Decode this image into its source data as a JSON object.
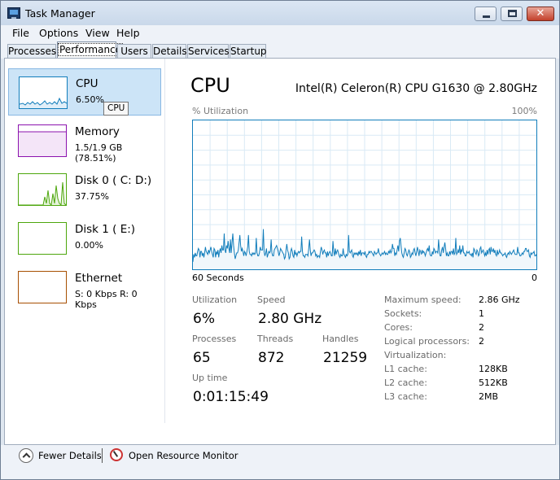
{
  "window": {
    "title": "Task Manager",
    "close_glyph": "✕"
  },
  "menu": [
    "File",
    "Options",
    "View",
    "Help"
  ],
  "tabs": [
    "Processes",
    "Performance",
    "Users",
    "Details",
    "Services",
    "Startup"
  ],
  "active_tab": "Performance",
  "resources": [
    {
      "name": "CPU",
      "detail": "6.50%",
      "color": "#117dbb",
      "selected": true
    },
    {
      "name": "Memory",
      "detail": "1.5/1.9 GB (78.51%)",
      "color": "#8b12ae",
      "selected": false
    },
    {
      "name": "Disk 0 ( C: D:)",
      "detail": "37.75%",
      "color": "#4da60c",
      "selected": false
    },
    {
      "name": "Disk 1 ( E:)",
      "detail": "0.00%",
      "color": "#4da60c",
      "selected": false
    },
    {
      "name": "Ethernet",
      "detail": "S: 0 Kbps R: 0 Kbps",
      "color": "#a74f01",
      "selected": false
    }
  ],
  "tooltip": "CPU",
  "cpu": {
    "heading": "CPU",
    "model": "Intel(R) Celeron(R) CPU G1630 @ 2.80GHz",
    "y_label": "% Utilization",
    "y_max_label": "100%",
    "x_left_label": "60 Seconds",
    "x_right_label": "0",
    "utilization_series": [
      5,
      10,
      8,
      11,
      9,
      9,
      12,
      14,
      13,
      8,
      12,
      12,
      9,
      11,
      8,
      11,
      15,
      12,
      11,
      10,
      13,
      11,
      13,
      15,
      12,
      10,
      8,
      14,
      13,
      8,
      12,
      10,
      13,
      8,
      12,
      14,
      11,
      16,
      13,
      13,
      24,
      13,
      11,
      16,
      14,
      19,
      14,
      11,
      20,
      11,
      18,
      24,
      16,
      11,
      7,
      9,
      11,
      11,
      13,
      18,
      23,
      16,
      12,
      14,
      12,
      9,
      12,
      11,
      9,
      12,
      15,
      23,
      12,
      10,
      10,
      9,
      11,
      10,
      11,
      10,
      11,
      21,
      11,
      9,
      9,
      11,
      15,
      13,
      13,
      13,
      27,
      12,
      9,
      11,
      14,
      8,
      10,
      12,
      11,
      12,
      20,
      11,
      9,
      9,
      13,
      14,
      15,
      16,
      14,
      12,
      9,
      11,
      14,
      13,
      12,
      11,
      10,
      7,
      8,
      13,
      17,
      13,
      11,
      7,
      8,
      12,
      14,
      12,
      9,
      8,
      13,
      10,
      11,
      9,
      11,
      12,
      11,
      12,
      12,
      22,
      12,
      9,
      9,
      8,
      10,
      10,
      10,
      9,
      14,
      20,
      13,
      9,
      11,
      11,
      12,
      13,
      12,
      9,
      10,
      8,
      9,
      9,
      8,
      12,
      15,
      13,
      10,
      12,
      13,
      11,
      11,
      8,
      12,
      9,
      11,
      12,
      11,
      9,
      9,
      19,
      12,
      9,
      14,
      10,
      12,
      13,
      11,
      9,
      8,
      10,
      9,
      9,
      14,
      10,
      9,
      8,
      10,
      9,
      10,
      23,
      12,
      11,
      12,
      13,
      9,
      8,
      11,
      10,
      11,
      10,
      11,
      9,
      12,
      10,
      13,
      9,
      11,
      11,
      11,
      10,
      12,
      9,
      8,
      10,
      10,
      12,
      11,
      12,
      12,
      11,
      10,
      9,
      12,
      11,
      10,
      11,
      11,
      14,
      11,
      10,
      9,
      10,
      11,
      10,
      11,
      12,
      10,
      11,
      10,
      10,
      12,
      11,
      13,
      11,
      12,
      17,
      14,
      14,
      9,
      11,
      10,
      13,
      16,
      12,
      19,
      21,
      16,
      11,
      9,
      8,
      11,
      14,
      13,
      10,
      9,
      11,
      13,
      12,
      8,
      9,
      11,
      10,
      13,
      14,
      11,
      9,
      12,
      15,
      12,
      9,
      13,
      12,
      10,
      13,
      11,
      12,
      11,
      9,
      11,
      13,
      14,
      12,
      16,
      10,
      9,
      9,
      12,
      10,
      14,
      13,
      11,
      12,
      12,
      11,
      20,
      13,
      9,
      9,
      13,
      15,
      11,
      15,
      18,
      14,
      9,
      11,
      9,
      9,
      12,
      10,
      12,
      12,
      10,
      14,
      10,
      11,
      21,
      10,
      11,
      13,
      11,
      16,
      10,
      13,
      12,
      16,
      11,
      11,
      9,
      9,
      12,
      11,
      11,
      12,
      10,
      10,
      9,
      11,
      8,
      14,
      13,
      11,
      10,
      13,
      12,
      9,
      10,
      14,
      15,
      11,
      12,
      13,
      11,
      9,
      11,
      9,
      13,
      10,
      13,
      14,
      10,
      15,
      12,
      12,
      14,
      11,
      13,
      10,
      9,
      13,
      10,
      11,
      13,
      11,
      11,
      10,
      9,
      10,
      10,
      11,
      9,
      8,
      10,
      11,
      10,
      12,
      11,
      10,
      11,
      12,
      13,
      11,
      10,
      10,
      10,
      15,
      11,
      11,
      9,
      9,
      10,
      11,
      10,
      12,
      12,
      14,
      14,
      12,
      12,
      13,
      9,
      8,
      11,
      10,
      11,
      11,
      12,
      9,
      9,
      10
    ],
    "stats_left": [
      {
        "label": "Utilization",
        "value": "6%"
      },
      {
        "label": "Speed",
        "value": "2.80 GHz"
      },
      {
        "label": "Processes",
        "value": "65"
      },
      {
        "label": "Threads",
        "value": "872"
      },
      {
        "label": "Handles",
        "value": "21259"
      },
      {
        "label": "Up time",
        "value": "0:01:15:49"
      }
    ],
    "details": [
      {
        "label": "Maximum speed:",
        "value": "2.86 GHz"
      },
      {
        "label": "Sockets:",
        "value": "1"
      },
      {
        "label": "Cores:",
        "value": "2"
      },
      {
        "label": "Logical processors:",
        "value": "2"
      },
      {
        "label": "Virtualization:",
        "value": ""
      },
      {
        "label": "L1 cache:",
        "value": "128KB"
      },
      {
        "label": "L2 cache:",
        "value": "512KB"
      },
      {
        "label": "L3 cache:",
        "value": "2MB"
      }
    ]
  },
  "footer": {
    "fewer_details": "Fewer Details",
    "resource_monitor": "Open Resource Monitor"
  }
}
